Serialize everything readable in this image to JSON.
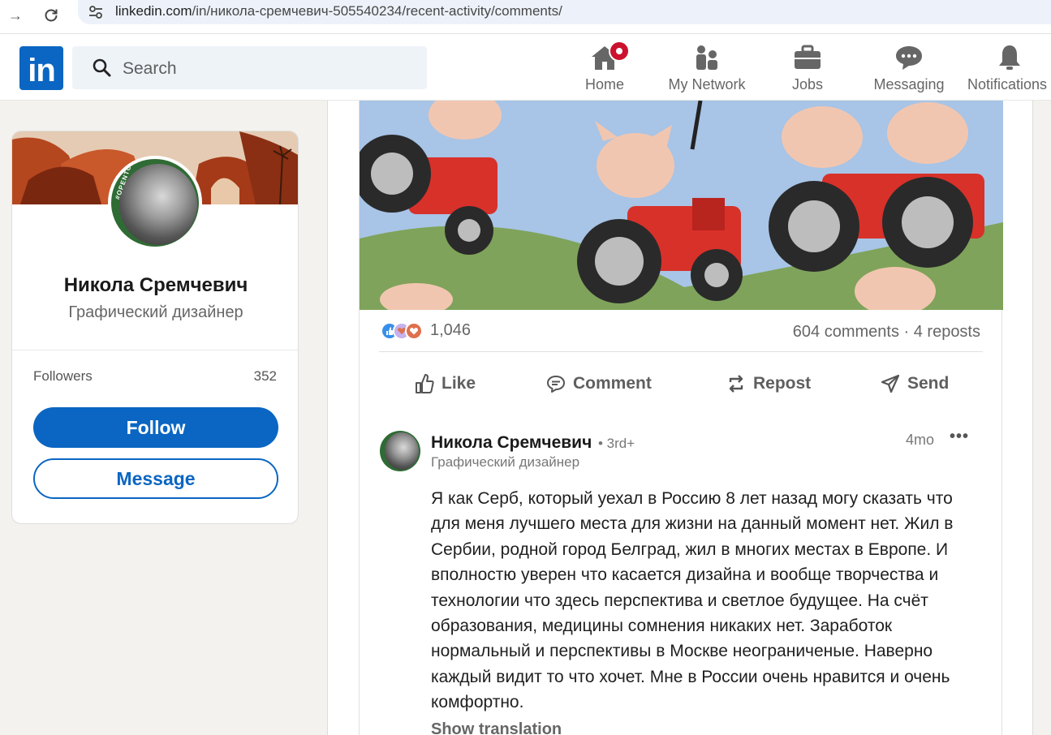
{
  "browser": {
    "url_domain": "linkedin.com",
    "url_path": "/in/никола-сремчевич-505540234/recent-activity/comments/"
  },
  "header": {
    "logo_text": "in",
    "search_placeholder": "Search",
    "nav": [
      {
        "label": "Home",
        "icon": "home-icon",
        "badge": true
      },
      {
        "label": "My Network",
        "icon": "network-icon"
      },
      {
        "label": "Jobs",
        "icon": "briefcase-icon"
      },
      {
        "label": "Messaging",
        "icon": "chat-icon"
      },
      {
        "label": "Notifications",
        "icon": "bell-icon"
      }
    ]
  },
  "profile": {
    "name": "Никола Сремчевич",
    "headline": "Графический дизайнер",
    "avatar_frame_text": "#OPENTOWORK",
    "followers_label": "Followers",
    "followers_count": "352",
    "follow_label": "Follow",
    "message_label": "Message"
  },
  "post": {
    "reaction_count": "1,046",
    "comments_reposts": "604 comments · 4 reposts",
    "actions": {
      "like": "Like",
      "comment": "Comment",
      "repost": "Repost",
      "send": "Send"
    }
  },
  "comment": {
    "author": "Никола Сремчевич",
    "degree": "• 3rd+",
    "author_title": "Графический дизайнер",
    "time": "4mo",
    "more": "•••",
    "text": "Я как Серб, который уехал в Россию 8 лет назад могу сказать что для меня лучшего места для жизни на данный момент нет. Жил в Сербии, родной город Белград, жил в многих местах в Европе. И вполностю уверен что касается дизайна и вообще творчества и технологии что здесь перспектива и светлое будущее. На счёт образования, медицины сомнения никаких нет. Заработок нормальный и перспективы в Москве неограниченые. Наверно каждый видит то что хочет. Мне в России очень нравится и очень комфортно.",
    "show_translation": "Show translation"
  },
  "colors": {
    "brand": "#0a66c2",
    "badge": "#cb112d",
    "page_bg": "#f4f2ee"
  }
}
